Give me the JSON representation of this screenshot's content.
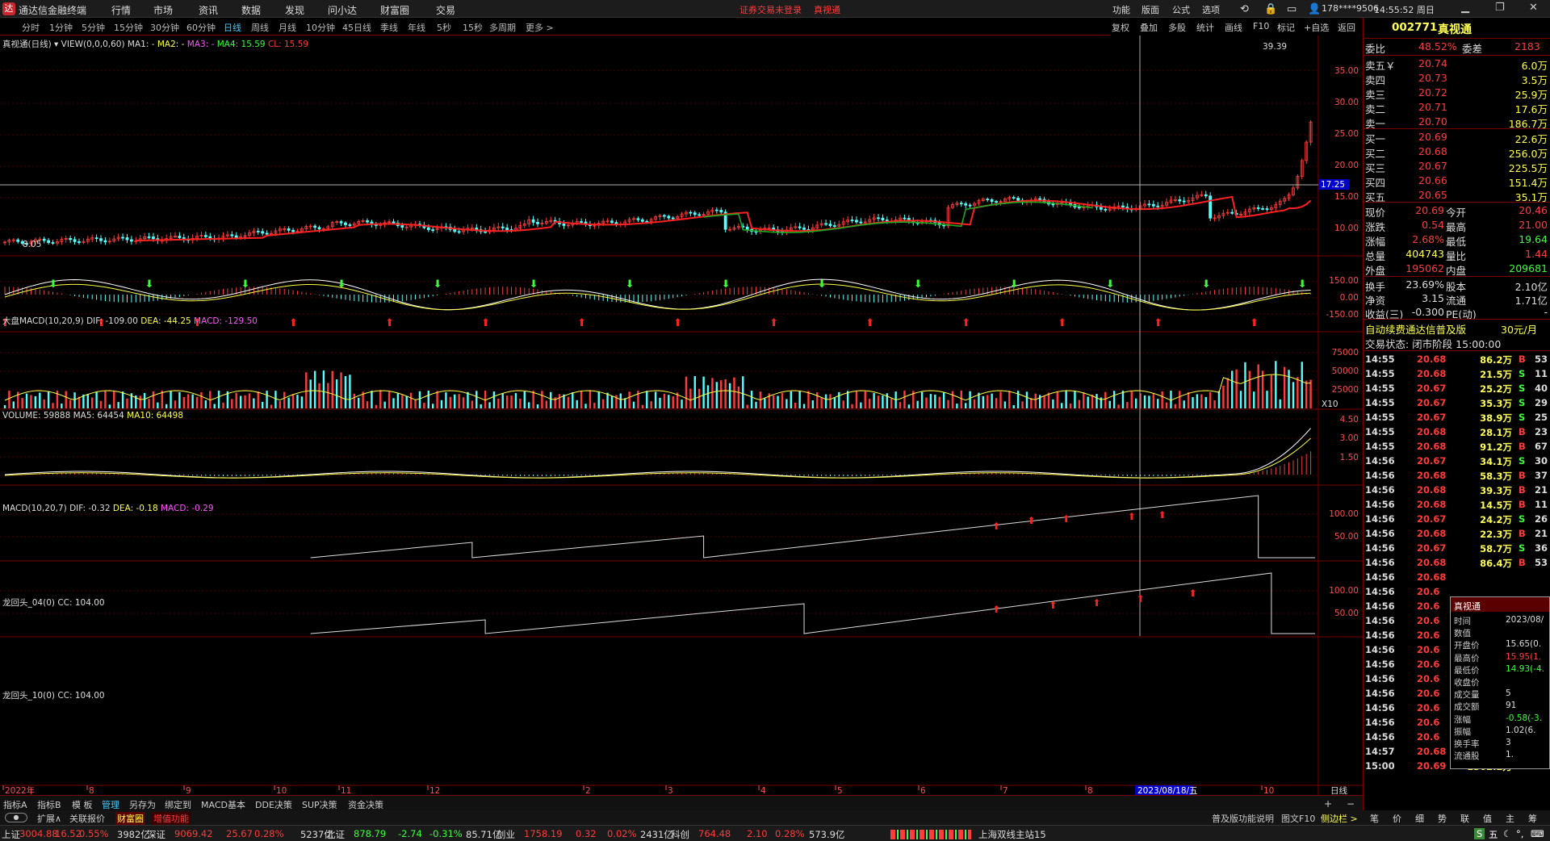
{
  "app": {
    "title": "通达信金融终端",
    "logo": "达"
  },
  "menu": [
    "行情",
    "市场",
    "资讯",
    "数据",
    "发现",
    "问小达",
    "财富圈",
    "交易"
  ],
  "warning": "证券交易未登录",
  "stock_link": "真视通",
  "right_menu": [
    "功能",
    "版面",
    "公式",
    "选项"
  ],
  "user": "178****9506",
  "clock": "14:55:52 周日",
  "periods": [
    "分时",
    "1分钟",
    "5分钟",
    "15分钟",
    "30分钟",
    "60分钟",
    "日线",
    "周线",
    "月线",
    "10分钟",
    "45日线",
    "季线",
    "年线",
    "5秒",
    "15秒",
    "多周期",
    "更多 >"
  ],
  "active_period": "日线",
  "tools": [
    "复权",
    "叠加",
    "多股",
    "统计",
    "画线",
    "F10",
    "标记",
    "+自选",
    "返回"
  ],
  "chart": {
    "main": {
      "name": "真视通(日线)",
      "view": "VIEW(0,0,0,60)",
      "ma1": "MA1: -",
      "ma2": "MA2: -",
      "ma3": "MA3: -",
      "ma4": "MA4: 15.59",
      "cl": "CL: 15.59",
      "high_label": "39.39",
      "low_label": "8.05",
      "price_tag": "17.25",
      "yticks": [
        "35.00",
        "30.00",
        "25.00",
        "20.00",
        "15.00",
        "10.00"
      ],
      "colors": {
        "up": "#ff3b3b",
        "down": "#54ffff",
        "ma_red": "#ff2020",
        "ma_green": "#1ea81e",
        "crosshair": "#b0b0b0"
      }
    },
    "dapan": {
      "name": "大盘MACD(10,20,9)",
      "dif": "DIF: -109.00",
      "dea": "DEA: -44.25",
      "macd": "MACD: -129.50",
      "yticks": [
        "150.00",
        "0.00",
        "-150.00"
      ]
    },
    "volume": {
      "name": "VOLUME: 59888",
      "ma5": "MA5: 64454",
      "ma10": "MA10: 64498",
      "yticks": [
        "75000",
        "50000",
        "25000"
      ],
      "unit": "X10"
    },
    "macd": {
      "name": "MACD(10,20,7)",
      "dif": "DIF: -0.32",
      "dea": "DEA: -0.18",
      "macd": "MACD: -0.29",
      "yticks": [
        "4.50",
        "3.00",
        "1.50"
      ]
    },
    "lht4": {
      "name": "龙回头_04(0)",
      "cc": "CC: 104.00",
      "yticks": [
        "100.00",
        "50.00"
      ]
    },
    "lht10": {
      "name": "龙回头_10(0)",
      "cc": "CC: 104.00",
      "yticks": [
        "100.00",
        "50.00"
      ]
    },
    "xaxis": [
      "2022年",
      "8",
      "9",
      "10",
      "11",
      "12",
      "2",
      "3",
      "4",
      "5",
      "6",
      "7",
      "8",
      "10"
    ],
    "cursor_date": "2023/08/18/五",
    "period_label": "日线"
  },
  "quote": {
    "code": "002771",
    "name": "真视通",
    "weibi": {
      "label": "委比",
      "value": "48.52%",
      "label2": "委差",
      "value2": "2183"
    },
    "sell": [
      {
        "label": "卖五￥",
        "price": "20.74",
        "vol": "6.0万"
      },
      {
        "label": "卖四",
        "price": "20.73",
        "vol": "3.5万"
      },
      {
        "label": "卖三",
        "price": "20.72",
        "vol": "25.9万"
      },
      {
        "label": "卖二",
        "price": "20.71",
        "vol": "17.6万"
      },
      {
        "label": "卖一",
        "price": "20.70",
        "vol": "186.7万"
      }
    ],
    "buy": [
      {
        "label": "买一",
        "price": "20.69",
        "vol": "22.6万"
      },
      {
        "label": "买二",
        "price": "20.68",
        "vol": "256.0万"
      },
      {
        "label": "买三",
        "price": "20.67",
        "vol": "225.5万"
      },
      {
        "label": "买四",
        "price": "20.66",
        "vol": "151.4万"
      },
      {
        "label": "买五",
        "price": "20.65",
        "vol": "35.1万"
      }
    ],
    "stats": [
      {
        "l1": "现价",
        "v1": "20.69",
        "l2": "今开",
        "v2": "20.46",
        "c1": "#ff3b3b",
        "c2": "#ff3b3b"
      },
      {
        "l1": "涨跌",
        "v1": "0.54",
        "l2": "最高",
        "v2": "21.00",
        "c1": "#ff3b3b",
        "c2": "#ff3b3b"
      },
      {
        "l1": "涨幅",
        "v1": "2.68%",
        "l2": "最低",
        "v2": "19.64",
        "c1": "#ff3b3b",
        "c2": "#39ff39"
      },
      {
        "l1": "总量",
        "v1": "404743",
        "l2": "量比",
        "v2": "1.44",
        "c1": "#ffff55",
        "c2": "#ff3b3b"
      },
      {
        "l1": "外盘",
        "v1": "195062",
        "l2": "内盘",
        "v2": "209681",
        "c1": "#ff3b3b",
        "c2": "#39ff39"
      }
    ],
    "stats2": [
      {
        "l1": "换手",
        "v1": "23.69%",
        "l2": "股本",
        "v2": "2.10亿"
      },
      {
        "l1": "净资",
        "v1": "3.15",
        "l2": "流通",
        "v2": "1.71亿"
      },
      {
        "l1": "收益(三)",
        "v1": "-0.300",
        "l2": "PE(动)",
        "v2": "-"
      }
    ],
    "promo": "自动续费通达信普及版",
    "promo_price": "30元/月",
    "trade_status": "交易状态: 闭市阶段 15:00:00"
  },
  "ticks": [
    {
      "t": "14:55",
      "p": "20.68",
      "v": "86.2万",
      "s": "B",
      "n": "53"
    },
    {
      "t": "14:55",
      "p": "20.68",
      "v": "21.5万",
      "s": "S",
      "n": "11"
    },
    {
      "t": "14:55",
      "p": "20.67",
      "v": "25.2万",
      "s": "S",
      "n": "40"
    },
    {
      "t": "14:55",
      "p": "20.67",
      "v": "35.3万",
      "s": "S",
      "n": "29"
    },
    {
      "t": "14:55",
      "p": "20.67",
      "v": "38.9万",
      "s": "S",
      "n": "25"
    },
    {
      "t": "14:55",
      "p": "20.68",
      "v": "28.1万",
      "s": "B",
      "n": "23"
    },
    {
      "t": "14:55",
      "p": "20.68",
      "v": "91.2万",
      "s": "B",
      "n": "67"
    },
    {
      "t": "14:56",
      "p": "20.67",
      "v": "34.1万",
      "s": "S",
      "n": "30"
    },
    {
      "t": "14:56",
      "p": "20.68",
      "v": "58.3万",
      "s": "B",
      "n": "37"
    },
    {
      "t": "14:56",
      "p": "20.68",
      "v": "39.3万",
      "s": "B",
      "n": "21"
    },
    {
      "t": "14:56",
      "p": "20.68",
      "v": "14.5万",
      "s": "B",
      "n": "11"
    },
    {
      "t": "14:56",
      "p": "20.67",
      "v": "24.2万",
      "s": "S",
      "n": "26"
    },
    {
      "t": "14:56",
      "p": "20.68",
      "v": "22.3万",
      "s": "B",
      "n": "21"
    },
    {
      "t": "14:56",
      "p": "20.67",
      "v": "58.7万",
      "s": "S",
      "n": "36"
    },
    {
      "t": "14:56",
      "p": "20.68",
      "v": "86.4万",
      "s": "B",
      "n": "53"
    },
    {
      "t": "14:56",
      "p": "20.68",
      "v": "",
      "s": "",
      "n": ""
    },
    {
      "t": "14:56",
      "p": "20.6",
      "v": "",
      "s": "",
      "n": ""
    },
    {
      "t": "14:56",
      "p": "20.6",
      "v": "",
      "s": "",
      "n": ""
    },
    {
      "t": "14:56",
      "p": "20.6",
      "v": "",
      "s": "",
      "n": ""
    },
    {
      "t": "14:56",
      "p": "20.6",
      "v": "",
      "s": "",
      "n": ""
    },
    {
      "t": "14:56",
      "p": "20.6",
      "v": "",
      "s": "",
      "n": ""
    },
    {
      "t": "14:56",
      "p": "20.6",
      "v": "",
      "s": "",
      "n": ""
    },
    {
      "t": "14:56",
      "p": "20.6",
      "v": "",
      "s": "",
      "n": ""
    },
    {
      "t": "14:56",
      "p": "20.6",
      "v": "",
      "s": "",
      "n": ""
    },
    {
      "t": "14:56",
      "p": "20.6",
      "v": "",
      "s": "",
      "n": ""
    },
    {
      "t": "14:56",
      "p": "20.6",
      "v": "",
      "s": "",
      "n": ""
    },
    {
      "t": "14:56",
      "p": "20.6",
      "v": "",
      "s": "",
      "n": ""
    },
    {
      "t": "14:57",
      "p": "20.68",
      "v": "39.3万",
      "s": "B",
      "n": "25"
    },
    {
      "t": "15:00",
      "p": "20.69",
      "v": "1302.2万",
      "s": "B",
      "n": "931"
    }
  ],
  "popup": {
    "title": "真视通",
    "rows": [
      {
        "k": "时间",
        "v": "2023/08/"
      },
      {
        "k": "数值",
        "v": ""
      },
      {
        "k": "开盘价",
        "v": "15.65(0."
      },
      {
        "k": "最高价",
        "v": "15.95(1."
      },
      {
        "k": "最低价",
        "v": "14.93(-4."
      },
      {
        "k": "收盘价",
        "v": ""
      },
      {
        "k": "成交量",
        "v": "5"
      },
      {
        "k": "成交额",
        "v": "91"
      },
      {
        "k": "涨幅",
        "v": "-0.58(-3."
      },
      {
        "k": "振幅",
        "v": "1.02(6."
      },
      {
        "k": "换手率",
        "v": "3"
      },
      {
        "k": "流通股",
        "v": "1."
      }
    ]
  },
  "tabs": [
    "指标A",
    "指标B",
    "模 板",
    "管理",
    "另存为",
    "绑定到",
    "MACD基本",
    "DDE决策",
    "SUP决策",
    "资金决策"
  ],
  "tabs2": [
    "扩展∧",
    "关联报价",
    "财富圈",
    "增值功能"
  ],
  "tabs2_right": [
    "普及版功能说明",
    "图文F10",
    "侧边栏 >"
  ],
  "side_tabs": [
    "笔",
    "价",
    "细",
    "势",
    "联",
    "值",
    "主",
    "筹"
  ],
  "index_bar": [
    {
      "name": "上证",
      "val": "3004.88",
      "chg": "16.52",
      "pct": "0.55%",
      "amt": "3982亿"
    },
    {
      "name": "深证",
      "val": "9069.42",
      "chg": "25.67",
      "pct": "0.28%",
      "amt": "5237亿"
    },
    {
      "name": "北证",
      "val": "878.79",
      "chg": "-2.74",
      "pct": "-0.31%",
      "amt": "85.71亿"
    },
    {
      "name": "创业",
      "val": "1758.19",
      "chg": "0.32",
      "pct": "0.02%",
      "amt": "2431亿"
    },
    {
      "name": "科创",
      "val": "764.48",
      "chg": "2.10",
      "pct": "0.28%",
      "amt": "573.9亿"
    }
  ],
  "server": "上海双线主站15"
}
